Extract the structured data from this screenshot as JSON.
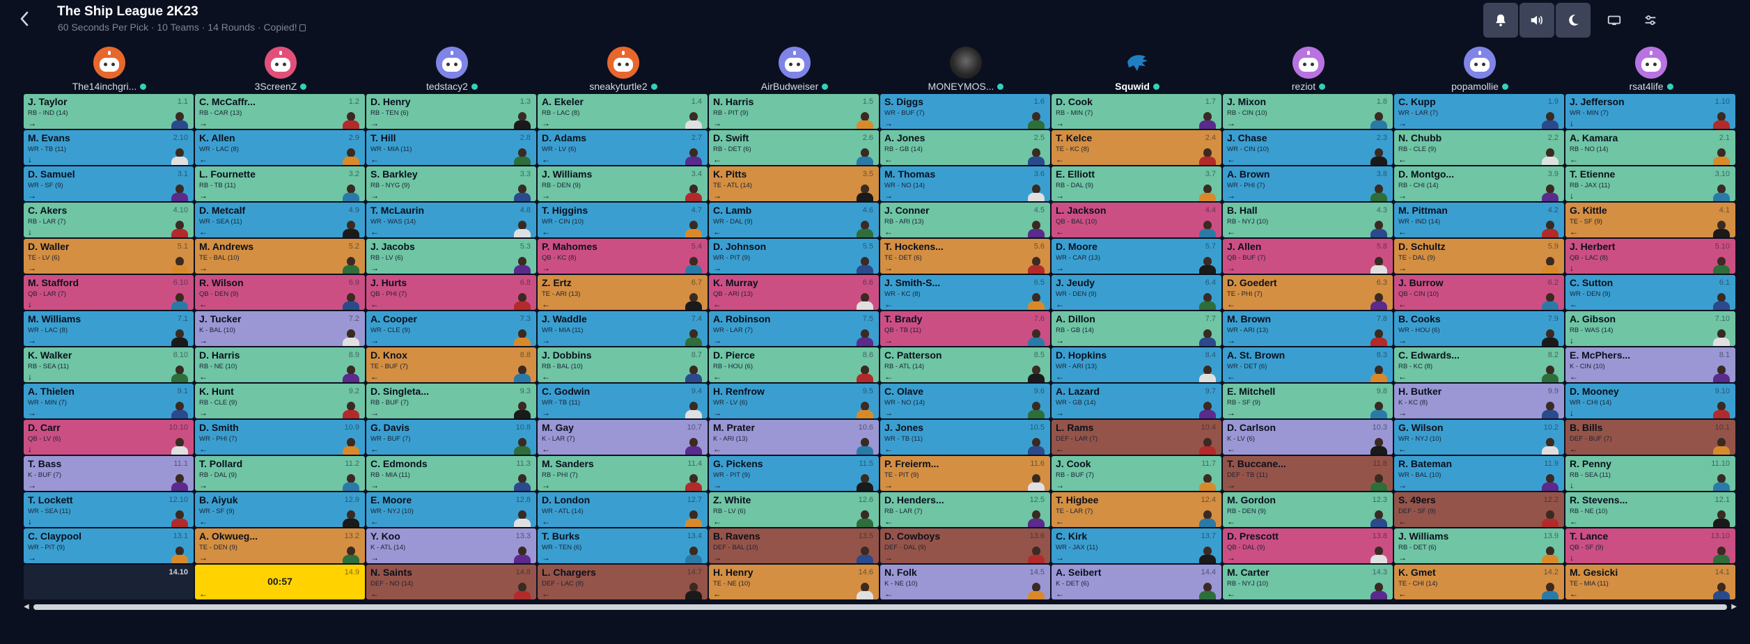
{
  "header": {
    "title": "The Ship League 2K23",
    "subtitle": "60 Seconds Per Pick · 10 Teams · 14 Rounds · Copied!"
  },
  "toolbar": [
    {
      "name": "notifications-button",
      "icon": "bell-icon"
    },
    {
      "name": "sound-button",
      "icon": "speaker-icon"
    },
    {
      "name": "dark-mode-button",
      "icon": "moon-icon"
    },
    {
      "name": "layout-toggle-button",
      "icon": "monitor-icon"
    },
    {
      "name": "settings-button",
      "icon": "sliders-icon"
    }
  ],
  "colors": {
    "RB": "#6fc5a4",
    "WR": "#3a9fd0",
    "TE": "#d48f42",
    "QB": "#cc4f84",
    "K": "#9a97d4",
    "DEF": "#955449",
    "on_clock": "#ffd200"
  },
  "teams": [
    {
      "name": "The14inchgri...",
      "avatar": "robot-orange"
    },
    {
      "name": "3ScreenZ",
      "avatar": "robot-pink"
    },
    {
      "name": "tedstacy2",
      "avatar": "robot-purple"
    },
    {
      "name": "sneakyturtle2",
      "avatar": "robot-orange"
    },
    {
      "name": "AirBudweiser",
      "avatar": "robot-purple"
    },
    {
      "name": "MONEYMOS...",
      "avatar": "photo"
    },
    {
      "name": "Squwid",
      "avatar": "lions-logo"
    },
    {
      "name": "reziot",
      "avatar": "robot-violet"
    },
    {
      "name": "popamollie",
      "avatar": "robot-purple"
    },
    {
      "name": "rsat4life",
      "avatar": "robot-violet"
    }
  ],
  "rounds": [
    [
      [
        "J. Taylor",
        "RB - IND (14)",
        "1.1",
        "→"
      ],
      [
        "C. McCaffr...",
        "RB - CAR (13)",
        "1.2",
        "→"
      ],
      [
        "D. Henry",
        "RB - TEN (6)",
        "1.3",
        "→"
      ],
      [
        "A. Ekeler",
        "RB - LAC (8)",
        "1.4",
        "→"
      ],
      [
        "N. Harris",
        "RB - PIT (9)",
        "1.5",
        "→"
      ],
      [
        "S. Diggs",
        "WR - BUF (7)",
        "1.6",
        "→"
      ],
      [
        "D. Cook",
        "RB - MIN (7)",
        "1.7",
        "→"
      ],
      [
        "J. Mixon",
        "RB - CIN (10)",
        "1.8",
        "→"
      ],
      [
        "C. Kupp",
        "WR - LAR (7)",
        "1.9",
        "→"
      ],
      [
        "J. Jefferson",
        "WR - MIN (7)",
        "1.10",
        "↓"
      ]
    ],
    [
      [
        "M. Evans",
        "WR - TB (11)",
        "2.10",
        "↓"
      ],
      [
        "K. Allen",
        "WR - LAC (8)",
        "2.9",
        "←"
      ],
      [
        "T. Hill",
        "WR - MIA (11)",
        "2.8",
        "←"
      ],
      [
        "D. Adams",
        "WR - LV (6)",
        "2.7",
        "←"
      ],
      [
        "D. Swift",
        "RB - DET (6)",
        "2.6",
        "←"
      ],
      [
        "A. Jones",
        "RB - GB (14)",
        "2.5",
        "←"
      ],
      [
        "T. Kelce",
        "TE - KC (8)",
        "2.4",
        "←"
      ],
      [
        "J. Chase",
        "WR - CIN (10)",
        "2.3",
        "←"
      ],
      [
        "N. Chubb",
        "RB - CLE (9)",
        "2.2",
        "←"
      ],
      [
        "A. Kamara",
        "RB - NO (14)",
        "2.1",
        "←"
      ]
    ],
    [
      [
        "D. Samuel",
        "WR - SF (9)",
        "3.1",
        "→"
      ],
      [
        "L. Fournette",
        "RB - TB (11)",
        "3.2",
        "→"
      ],
      [
        "S. Barkley",
        "RB - NYG (9)",
        "3.3",
        "→"
      ],
      [
        "J. Williams",
        "RB - DEN (9)",
        "3.4",
        "→"
      ],
      [
        "K. Pitts",
        "TE - ATL (14)",
        "3.5",
        "→"
      ],
      [
        "M. Thomas",
        "WR - NO (14)",
        "3.6",
        "→"
      ],
      [
        "E. Elliott",
        "RB - DAL (9)",
        "3.7",
        "→"
      ],
      [
        "A. Brown",
        "WR - PHI (7)",
        "3.8",
        "→"
      ],
      [
        "D. Montgo...",
        "RB - CHI (14)",
        "3.9",
        "→"
      ],
      [
        "T. Etienne",
        "RB - JAX (11)",
        "3.10",
        "↓"
      ]
    ],
    [
      [
        "C. Akers",
        "RB - LAR (7)",
        "4.10",
        "↓"
      ],
      [
        "D. Metcalf",
        "WR - SEA (11)",
        "4.9",
        "←"
      ],
      [
        "T. McLaurin",
        "WR - WAS (14)",
        "4.8",
        "←"
      ],
      [
        "T. Higgins",
        "WR - CIN (10)",
        "4.7",
        "←"
      ],
      [
        "C. Lamb",
        "WR - DAL (9)",
        "4.6",
        "←"
      ],
      [
        "J. Conner",
        "RB - ARI (13)",
        "4.5",
        "←"
      ],
      [
        "L. Jackson",
        "QB - BAL (10)",
        "4.4",
        "←"
      ],
      [
        "B. Hall",
        "RB - NYJ (10)",
        "4.3",
        "←"
      ],
      [
        "M. Pittman",
        "WR - IND (14)",
        "4.2",
        "←"
      ],
      [
        "G. Kittle",
        "TE - SF (9)",
        "4.1",
        "←"
      ]
    ],
    [
      [
        "D. Waller",
        "TE - LV (6)",
        "5.1",
        "→"
      ],
      [
        "M. Andrews",
        "TE - BAL (10)",
        "5.2",
        "→"
      ],
      [
        "J. Jacobs",
        "RB - LV (6)",
        "5.3",
        "→"
      ],
      [
        "P. Mahomes",
        "QB - KC (8)",
        "5.4",
        "→"
      ],
      [
        "D. Johnson",
        "WR - PIT (9)",
        "5.5",
        "→"
      ],
      [
        "T. Hockens...",
        "TE - DET (6)",
        "5.6",
        "→"
      ],
      [
        "D. Moore",
        "WR - CAR (13)",
        "5.7",
        "→"
      ],
      [
        "J. Allen",
        "QB - BUF (7)",
        "5.8",
        "→"
      ],
      [
        "D. Schultz",
        "TE - DAL (9)",
        "5.9",
        "→"
      ],
      [
        "J. Herbert",
        "QB - LAC (8)",
        "5.10",
        "↓"
      ]
    ],
    [
      [
        "M. Stafford",
        "QB - LAR (7)",
        "6.10",
        "↓"
      ],
      [
        "R. Wilson",
        "QB - DEN (9)",
        "6.9",
        "←"
      ],
      [
        "J. Hurts",
        "QB - PHI (7)",
        "6.8",
        "←"
      ],
      [
        "Z. Ertz",
        "TE - ARI (13)",
        "6.7",
        "←"
      ],
      [
        "K. Murray",
        "QB - ARI (13)",
        "6.6",
        "←"
      ],
      [
        "J. Smith-S...",
        "WR - KC (8)",
        "6.5",
        "←"
      ],
      [
        "J. Jeudy",
        "WR - DEN (9)",
        "6.4",
        "←"
      ],
      [
        "D. Goedert",
        "TE - PHI (7)",
        "6.3",
        "←"
      ],
      [
        "J. Burrow",
        "QB - CIN (10)",
        "6.2",
        "←"
      ],
      [
        "C. Sutton",
        "WR - DEN (9)",
        "6.1",
        "←"
      ]
    ],
    [
      [
        "M. Williams",
        "WR - LAC (8)",
        "7.1",
        "→"
      ],
      [
        "J. Tucker",
        "K - BAL (10)",
        "7.2",
        "→"
      ],
      [
        "A. Cooper",
        "WR - CLE (9)",
        "7.3",
        "→"
      ],
      [
        "J. Waddle",
        "WR - MIA (11)",
        "7.4",
        "→"
      ],
      [
        "A. Robinson",
        "WR - LAR (7)",
        "7.5",
        "→"
      ],
      [
        "T. Brady",
        "QB - TB (11)",
        "7.6",
        "→"
      ],
      [
        "A. Dillon",
        "RB - GB (14)",
        "7.7",
        "→"
      ],
      [
        "M. Brown",
        "WR - ARI (13)",
        "7.8",
        "→"
      ],
      [
        "B. Cooks",
        "WR - HOU (6)",
        "7.9",
        "→"
      ],
      [
        "A. Gibson",
        "RB - WAS (14)",
        "7.10",
        "↓"
      ]
    ],
    [
      [
        "K. Walker",
        "RB - SEA (11)",
        "8.10",
        "↓"
      ],
      [
        "D. Harris",
        "RB - NE (10)",
        "8.9",
        "←"
      ],
      [
        "D. Knox",
        "TE - BUF (7)",
        "8.8",
        "←"
      ],
      [
        "J. Dobbins",
        "RB - BAL (10)",
        "8.7",
        "←"
      ],
      [
        "D. Pierce",
        "RB - HOU (6)",
        "8.6",
        "←"
      ],
      [
        "C. Patterson",
        "RB - ATL (14)",
        "8.5",
        "←"
      ],
      [
        "D. Hopkins",
        "WR - ARI (13)",
        "8.4",
        "←"
      ],
      [
        "A. St. Brown",
        "WR - DET (6)",
        "8.3",
        "←"
      ],
      [
        "C. Edwards...",
        "RB - KC (8)",
        "8.2",
        "←"
      ],
      [
        "E. McPhers...",
        "K - CIN (10)",
        "8.1",
        "←"
      ]
    ],
    [
      [
        "A. Thielen",
        "WR - MIN (7)",
        "9.1",
        "→"
      ],
      [
        "K. Hunt",
        "RB - CLE (9)",
        "9.2",
        "→"
      ],
      [
        "D. Singleta...",
        "RB - BUF (7)",
        "9.3",
        "→"
      ],
      [
        "C. Godwin",
        "WR - TB (11)",
        "9.4",
        "→"
      ],
      [
        "H. Renfrow",
        "WR - LV (6)",
        "9.5",
        "→"
      ],
      [
        "C. Olave",
        "WR - NO (14)",
        "9.6",
        "→"
      ],
      [
        "A. Lazard",
        "WR - GB (14)",
        "9.7",
        "→"
      ],
      [
        "E. Mitchell",
        "RB - SF (9)",
        "9.8",
        "→"
      ],
      [
        "H. Butker",
        "K - KC (8)",
        "9.9",
        "→"
      ],
      [
        "D. Mooney",
        "WR - CHI (14)",
        "9.10",
        "↓"
      ]
    ],
    [
      [
        "D. Carr",
        "QB - LV (6)",
        "10.10",
        "↓"
      ],
      [
        "D. Smith",
        "WR - PHI (7)",
        "10.9",
        "←"
      ],
      [
        "G. Davis",
        "WR - BUF (7)",
        "10.8",
        "←"
      ],
      [
        "M. Gay",
        "K - LAR (7)",
        "10.7",
        "←"
      ],
      [
        "M. Prater",
        "K - ARI (13)",
        "10.6",
        "←"
      ],
      [
        "J. Jones",
        "WR - TB (11)",
        "10.5",
        "←"
      ],
      [
        "L. Rams",
        "DEF - LAR (7)",
        "10.4",
        "←"
      ],
      [
        "D. Carlson",
        "K - LV (6)",
        "10.3",
        "←"
      ],
      [
        "G. Wilson",
        "WR - NYJ (10)",
        "10.2",
        "←"
      ],
      [
        "B. Bills",
        "DEF - BUF (7)",
        "10.1",
        "←"
      ]
    ],
    [
      [
        "T. Bass",
        "K - BUF (7)",
        "11.1",
        "→"
      ],
      [
        "T. Pollard",
        "RB - DAL (9)",
        "11.2",
        "→"
      ],
      [
        "C. Edmonds",
        "RB - MIA (11)",
        "11.3",
        "→"
      ],
      [
        "M. Sanders",
        "RB - PHI (7)",
        "11.4",
        "→"
      ],
      [
        "G. Pickens",
        "WR - PIT (9)",
        "11.5",
        "→"
      ],
      [
        "P. Freierm...",
        "TE - PIT (9)",
        "11.6",
        "→"
      ],
      [
        "J. Cook",
        "RB - BUF (7)",
        "11.7",
        "→"
      ],
      [
        "T. Buccane...",
        "DEF - TB (11)",
        "11.8",
        "→"
      ],
      [
        "R. Bateman",
        "WR - BAL (10)",
        "11.9",
        "→"
      ],
      [
        "R. Penny",
        "RB - SEA (11)",
        "11.10",
        "↓"
      ]
    ],
    [
      [
        "T. Lockett",
        "WR - SEA (11)",
        "12.10",
        "↓"
      ],
      [
        "B. Aiyuk",
        "WR - SF (9)",
        "12.9",
        "←"
      ],
      [
        "E. Moore",
        "WR - NYJ (10)",
        "12.8",
        "←"
      ],
      [
        "D. London",
        "WR - ATL (14)",
        "12.7",
        "←"
      ],
      [
        "Z. White",
        "RB - LV (6)",
        "12.6",
        "←"
      ],
      [
        "D. Henders...",
        "RB - LAR (7)",
        "12.5",
        "←"
      ],
      [
        "T. Higbee",
        "TE - LAR (7)",
        "12.4",
        "←"
      ],
      [
        "M. Gordon",
        "RB - DEN (9)",
        "12.3",
        "←"
      ],
      [
        "S. 49ers",
        "DEF - SF (9)",
        "12.2",
        "←"
      ],
      [
        "R. Stevens...",
        "RB - NE (10)",
        "12.1",
        "←"
      ]
    ],
    [
      [
        "C. Claypool",
        "WR - PIT (9)",
        "13.1",
        "→"
      ],
      [
        "A. Okwueg...",
        "TE - DEN (9)",
        "13.2",
        "→"
      ],
      [
        "Y. Koo",
        "K - ATL (14)",
        "13.3",
        "→"
      ],
      [
        "T. Burks",
        "WR - TEN (6)",
        "13.4",
        "→"
      ],
      [
        "B. Ravens",
        "DEF - BAL (10)",
        "13.5",
        "→"
      ],
      [
        "D. Cowboys",
        "DEF - DAL (9)",
        "13.6",
        "→"
      ],
      [
        "C. Kirk",
        "WR - JAX (11)",
        "13.7",
        "→"
      ],
      [
        "D. Prescott",
        "QB - DAL (9)",
        "13.8",
        "→"
      ],
      [
        "J. Williams",
        "RB - DET (6)",
        "13.9",
        "→"
      ],
      [
        "T. Lance",
        "QB - SF (9)",
        "13.10",
        "↓"
      ]
    ],
    [
      [
        "",
        "",
        "14.10",
        ""
      ],
      [
        "",
        "",
        "14.9",
        "←"
      ],
      [
        "N. Saints",
        "DEF - NO (14)",
        "14.8",
        "←"
      ],
      [
        "L. Chargers",
        "DEF - LAC (8)",
        "14.7",
        "←"
      ],
      [
        "H. Henry",
        "TE - NE (10)",
        "14.6",
        "←"
      ],
      [
        "N. Folk",
        "K - NE (10)",
        "14.5",
        "←"
      ],
      [
        "A. Seibert",
        "K - DET (6)",
        "14.4",
        "←"
      ],
      [
        "M. Carter",
        "RB - NYJ (10)",
        "14.3",
        "←"
      ],
      [
        "K. Gmet",
        "TE - CHI (14)",
        "14.2",
        "←"
      ],
      [
        "M. Gesicki",
        "TE - MIA (11)",
        "14.1",
        "←"
      ]
    ]
  ],
  "on_clock": {
    "timer": "00:57"
  }
}
